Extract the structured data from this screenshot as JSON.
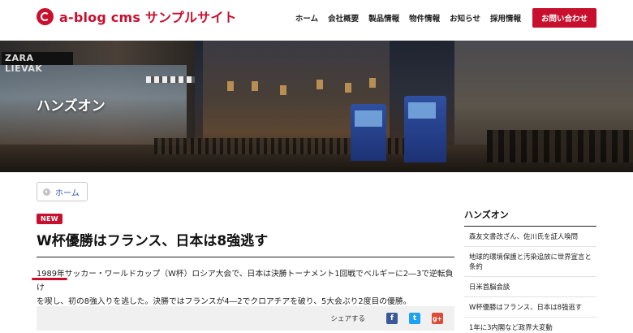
{
  "header": {
    "logo_text": "a-blog cms サンプルサイト",
    "nav": [
      "ホーム",
      "会社概要",
      "製品情報",
      "物件情報",
      "お知らせ",
      "採用情報"
    ],
    "cta": "お問い合わせ"
  },
  "hero": {
    "title": "ハンズオン",
    "sign_text": "ZARA LIEVAK"
  },
  "breadcrumb": {
    "home": "ホーム"
  },
  "article": {
    "badge": "NEW",
    "title": "W杯優勝はフランス、日本は8強逃す",
    "body_line1": "1989年サッカー・ワールドカップ（W杯）ロシア大会で、日本は決勝トーナメント1回戦でベルギーに2―3で逆転負け",
    "body_line2": "を喫し、初の8強入りを逃した。決勝ではフランスが4―2でクロアチアを破り、5大会ぶり2度目の優勝。"
  },
  "share": {
    "label": "シェアする",
    "buttons": [
      {
        "icon": "facebook-icon",
        "glyph": "f",
        "color": "#3b5998"
      },
      {
        "icon": "twitter-icon",
        "glyph": "t",
        "color": "#1da1f2"
      },
      {
        "icon": "google-plus-icon",
        "glyph": "g+",
        "color": "#dd4b39"
      }
    ]
  },
  "sidebar": {
    "title": "ハンズオン",
    "items": [
      "森友文書改ざん、佐川氏を証人喚問",
      "地球的環境保護と汚染追放に世界宣言と条約",
      "日米首脳会談",
      "W杯優勝はフランス、日本は8強逃す",
      "1年に3内閣など政界大変動"
    ]
  },
  "colors": {
    "accent": "#c8102e",
    "link": "#3a55b0"
  }
}
